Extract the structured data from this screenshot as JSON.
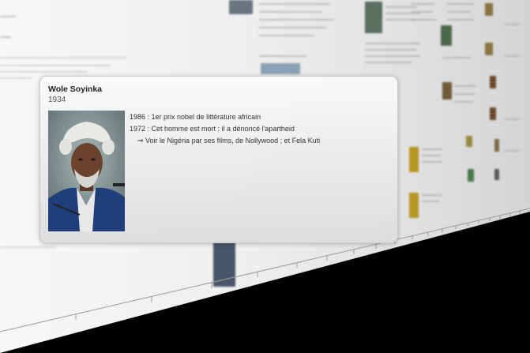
{
  "popup": {
    "title": "Wole Soyinka",
    "year": "1934",
    "events": [
      "1986 : 1er prix nobel de littérature africain",
      "1972 : Cet homme est mort ; il a dénoncé l'apartheid",
      "⇒ Voir le Nigéria par ses films, de Nollywood ; et Fela Kuti"
    ],
    "portrait_icon": "person-portrait"
  },
  "colors": {
    "wall_light": "#f7f7f7",
    "wall_dark": "#d4d4d4",
    "card_bg": "#ececec",
    "backdrop": "#000000"
  }
}
